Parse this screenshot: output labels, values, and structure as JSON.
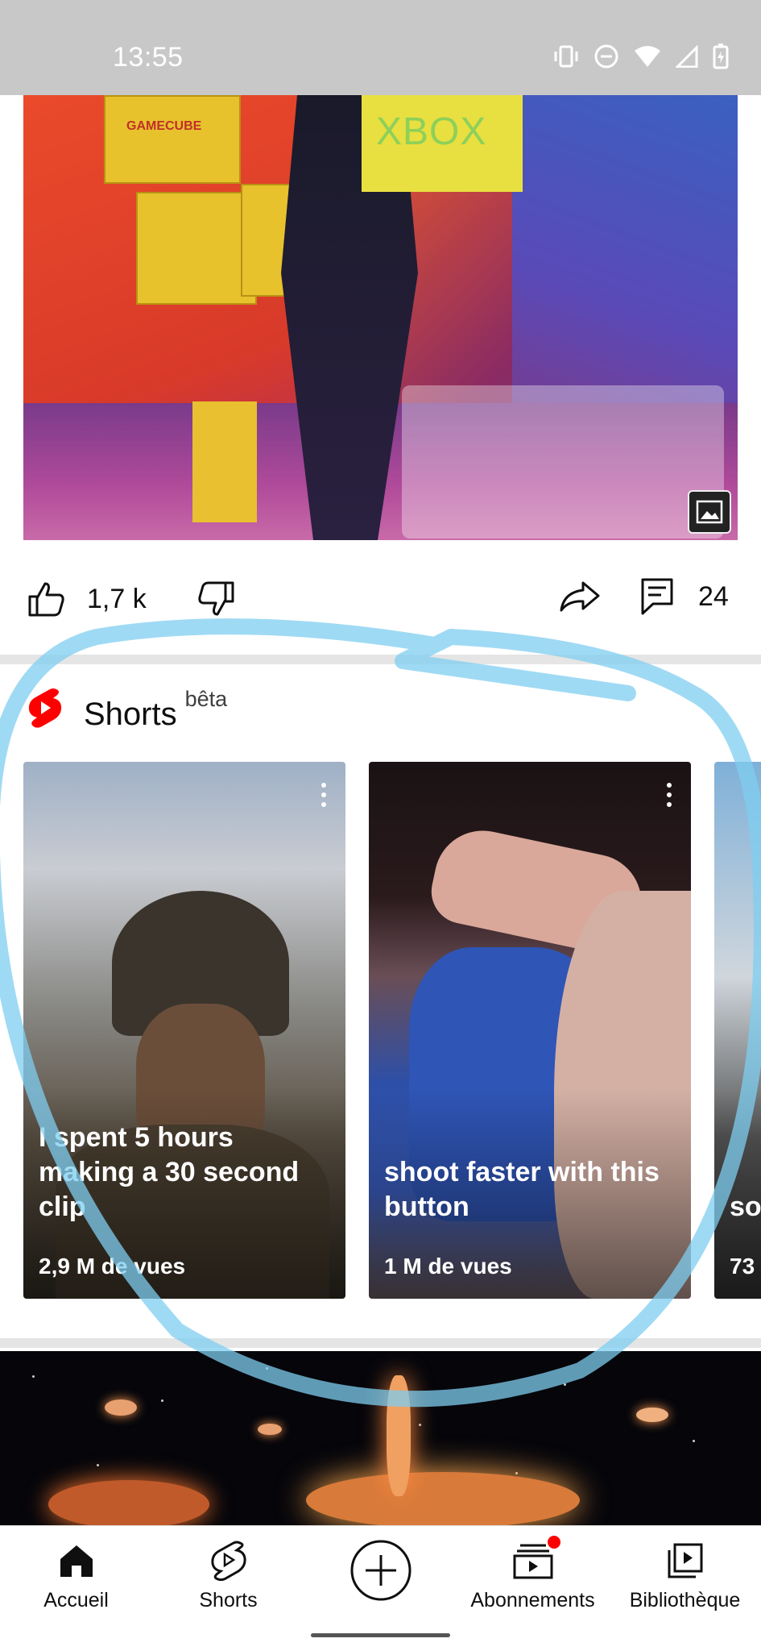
{
  "status_bar": {
    "time": "13:55",
    "icons": [
      "vibrate-icon",
      "dnd-icon",
      "wifi-icon",
      "signal-icon",
      "battery-icon"
    ]
  },
  "post": {
    "image_alt_icon": "image-gallery-icon",
    "image_texts": [
      "XBOX",
      "GAMECUBE"
    ],
    "likes": "1,7 k",
    "comments": "24"
  },
  "shorts": {
    "title": "Shorts",
    "badge": "bêta",
    "items": [
      {
        "title": "I spent 5 hours making a 30 second clip",
        "views": "2,9 M de vues"
      },
      {
        "title": "shoot faster with this button",
        "views": "1 M de vues"
      },
      {
        "title": "so do",
        "views": "73"
      }
    ]
  },
  "bottom_nav": {
    "items": [
      {
        "label": "Accueil",
        "icon": "home-icon"
      },
      {
        "label": "Shorts",
        "icon": "shorts-icon"
      },
      {
        "label": "",
        "icon": "create-plus-icon"
      },
      {
        "label": "Abonnements",
        "icon": "subscriptions-icon"
      },
      {
        "label": "Bibliothèque",
        "icon": "library-icon"
      }
    ]
  },
  "colors": {
    "accent_red": "#ff0000",
    "annotation_blue": "#7fcdf0",
    "status_bar_bg": "#c8c8c8"
  }
}
